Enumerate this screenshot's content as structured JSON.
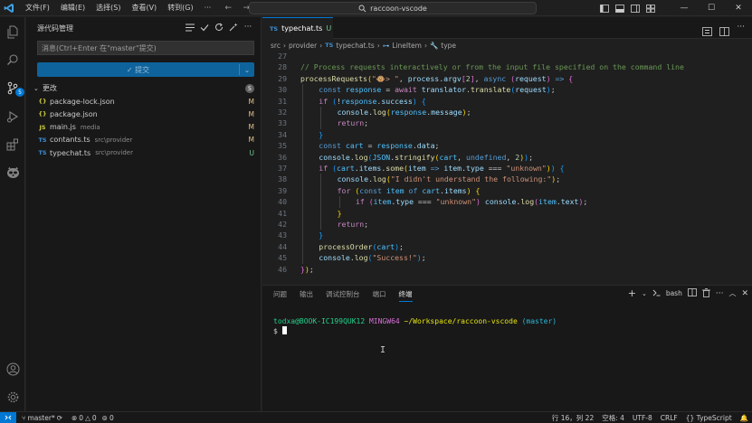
{
  "titlebar": {
    "menus": [
      "文件(F)",
      "编辑(E)",
      "选择(S)",
      "查看(V)",
      "转到(G)",
      "···"
    ],
    "search": "raccoon-vscode"
  },
  "activity_badge": "5",
  "scm": {
    "title": "源代码管理",
    "message_placeholder": "消息(Ctrl+Enter 在\"master\"提交)",
    "commit_label": "提交",
    "changes_label": "更改",
    "changes_count": "5",
    "files": [
      {
        "type": "{}",
        "type_color": "#cbcb41",
        "name": "package-lock.json",
        "path": "",
        "status": "M",
        "status_color": "#e2c08d"
      },
      {
        "type": "{}",
        "type_color": "#cbcb41",
        "name": "package.json",
        "path": "",
        "status": "M",
        "status_color": "#e2c08d"
      },
      {
        "type": "JS",
        "type_color": "#cbcb41",
        "name": "main.js",
        "path": "media",
        "status": "M",
        "status_color": "#e2c08d"
      },
      {
        "type": "TS",
        "type_color": "#3c8fd6",
        "name": "contants.ts",
        "path": "src\\provider",
        "status": "M",
        "status_color": "#e2c08d"
      },
      {
        "type": "TS",
        "type_color": "#3c8fd6",
        "name": "typechat.ts",
        "path": "src\\provider",
        "status": "U",
        "status_color": "#73c991"
      }
    ]
  },
  "editor": {
    "tab": {
      "type": "TS",
      "name": "typechat.ts",
      "status": "U"
    },
    "breadcrumb": {
      "p1": "src",
      "p2": "provider",
      "p3_type": "TS",
      "p3": "typechat.ts",
      "p4": "LineItem",
      "p5": "type"
    },
    "lines": [
      {
        "n": "27",
        "indent": 0,
        "tokens": []
      },
      {
        "n": "28",
        "indent": 0,
        "tokens": [
          [
            "// Process requests interactively or from the input file specified on the command line",
            "c-com"
          ]
        ]
      },
      {
        "n": "29",
        "indent": 0,
        "tokens": [
          [
            "processRequests",
            "c-fn"
          ],
          [
            "(",
            "c-br1"
          ],
          [
            "\"",
            "c-str"
          ],
          [
            "🐵",
            "c-str"
          ],
          [
            "> \"",
            "c-str"
          ],
          [
            ", ",
            "c-pun"
          ],
          [
            "process",
            "c-var"
          ],
          [
            ".",
            "c-pun"
          ],
          [
            "argv",
            "c-var"
          ],
          [
            "[",
            "c-br2"
          ],
          [
            "2",
            "c-num"
          ],
          [
            "]",
            "c-br2"
          ],
          [
            ", ",
            "c-pun"
          ],
          [
            "async",
            "c-kw"
          ],
          [
            " ",
            "c-pun"
          ],
          [
            "(",
            "c-br2"
          ],
          [
            "request",
            "c-var"
          ],
          [
            ")",
            "c-br2"
          ],
          [
            " ",
            "c-pun"
          ],
          [
            "=>",
            "c-kw"
          ],
          [
            " ",
            "c-pun"
          ],
          [
            "{",
            "c-br2"
          ]
        ]
      },
      {
        "n": "30",
        "indent": 1,
        "tokens": [
          [
            "const",
            "c-kw"
          ],
          [
            " ",
            "c-pun"
          ],
          [
            "response",
            "c-const"
          ],
          [
            " = ",
            "c-pun"
          ],
          [
            "await",
            "c-ctl"
          ],
          [
            " ",
            "c-pun"
          ],
          [
            "translator",
            "c-var"
          ],
          [
            ".",
            "c-pun"
          ],
          [
            "translate",
            "c-fn"
          ],
          [
            "(",
            "c-br3"
          ],
          [
            "request",
            "c-var"
          ],
          [
            ")",
            "c-br3"
          ],
          [
            ";",
            "c-pun"
          ]
        ]
      },
      {
        "n": "31",
        "indent": 1,
        "tokens": [
          [
            "if",
            "c-ctl"
          ],
          [
            " ",
            "c-pun"
          ],
          [
            "(",
            "c-br3"
          ],
          [
            "!",
            "c-pun"
          ],
          [
            "response",
            "c-const"
          ],
          [
            ".",
            "c-pun"
          ],
          [
            "success",
            "c-var"
          ],
          [
            ")",
            "c-br3"
          ],
          [
            " ",
            "c-pun"
          ],
          [
            "{",
            "c-br3"
          ]
        ]
      },
      {
        "n": "32",
        "indent": 2,
        "tokens": [
          [
            "console",
            "c-var"
          ],
          [
            ".",
            "c-pun"
          ],
          [
            "log",
            "c-fn"
          ],
          [
            "(",
            "c-br1"
          ],
          [
            "response",
            "c-const"
          ],
          [
            ".",
            "c-pun"
          ],
          [
            "message",
            "c-var"
          ],
          [
            ")",
            "c-br1"
          ],
          [
            ";",
            "c-pun"
          ]
        ]
      },
      {
        "n": "33",
        "indent": 2,
        "tokens": [
          [
            "return",
            "c-ctl"
          ],
          [
            ";",
            "c-pun"
          ]
        ]
      },
      {
        "n": "34",
        "indent": 1,
        "tokens": [
          [
            "}",
            "c-br3"
          ]
        ]
      },
      {
        "n": "35",
        "indent": 1,
        "tokens": [
          [
            "const",
            "c-kw"
          ],
          [
            " ",
            "c-pun"
          ],
          [
            "cart",
            "c-const"
          ],
          [
            " = ",
            "c-pun"
          ],
          [
            "response",
            "c-const"
          ],
          [
            ".",
            "c-pun"
          ],
          [
            "data",
            "c-var"
          ],
          [
            ";",
            "c-pun"
          ]
        ]
      },
      {
        "n": "36",
        "indent": 1,
        "tokens": [
          [
            "console",
            "c-var"
          ],
          [
            ".",
            "c-pun"
          ],
          [
            "log",
            "c-fn"
          ],
          [
            "(",
            "c-br3"
          ],
          [
            "JSON",
            "c-const"
          ],
          [
            ".",
            "c-pun"
          ],
          [
            "stringify",
            "c-fn"
          ],
          [
            "(",
            "c-br1"
          ],
          [
            "cart",
            "c-const"
          ],
          [
            ", ",
            "c-pun"
          ],
          [
            "undefined",
            "c-kw"
          ],
          [
            ", ",
            "c-pun"
          ],
          [
            "2",
            "c-num"
          ],
          [
            ")",
            "c-br1"
          ],
          [
            ")",
            "c-br3"
          ],
          [
            ";",
            "c-pun"
          ]
        ]
      },
      {
        "n": "37",
        "indent": 1,
        "tokens": [
          [
            "if",
            "c-ctl"
          ],
          [
            " ",
            "c-pun"
          ],
          [
            "(",
            "c-br3"
          ],
          [
            "cart",
            "c-const"
          ],
          [
            ".",
            "c-pun"
          ],
          [
            "items",
            "c-var"
          ],
          [
            ".",
            "c-pun"
          ],
          [
            "some",
            "c-fn"
          ],
          [
            "(",
            "c-br1"
          ],
          [
            "item",
            "c-var"
          ],
          [
            " ",
            "c-pun"
          ],
          [
            "=>",
            "c-kw"
          ],
          [
            " ",
            "c-pun"
          ],
          [
            "item",
            "c-var"
          ],
          [
            ".",
            "c-pun"
          ],
          [
            "type",
            "c-var"
          ],
          [
            " === ",
            "c-pun"
          ],
          [
            "\"unknown\"",
            "c-str"
          ],
          [
            ")",
            "c-br1"
          ],
          [
            ")",
            "c-br3"
          ],
          [
            " ",
            "c-pun"
          ],
          [
            "{",
            "c-br3"
          ]
        ]
      },
      {
        "n": "38",
        "indent": 2,
        "tokens": [
          [
            "console",
            "c-var"
          ],
          [
            ".",
            "c-pun"
          ],
          [
            "log",
            "c-fn"
          ],
          [
            "(",
            "c-br1"
          ],
          [
            "\"I didn't understand the following:\"",
            "c-str"
          ],
          [
            ")",
            "c-br1"
          ],
          [
            ";",
            "c-pun"
          ]
        ]
      },
      {
        "n": "39",
        "indent": 2,
        "tokens": [
          [
            "for",
            "c-ctl"
          ],
          [
            " ",
            "c-pun"
          ],
          [
            "(",
            "c-br1"
          ],
          [
            "const",
            "c-kw"
          ],
          [
            " ",
            "c-pun"
          ],
          [
            "item",
            "c-const"
          ],
          [
            " ",
            "c-pun"
          ],
          [
            "of",
            "c-kw"
          ],
          [
            " ",
            "c-pun"
          ],
          [
            "cart",
            "c-const"
          ],
          [
            ".",
            "c-pun"
          ],
          [
            "items",
            "c-var"
          ],
          [
            ")",
            "c-br1"
          ],
          [
            " ",
            "c-pun"
          ],
          [
            "{",
            "c-br1"
          ]
        ]
      },
      {
        "n": "40",
        "indent": 3,
        "tokens": [
          [
            "if",
            "c-ctl"
          ],
          [
            " ",
            "c-pun"
          ],
          [
            "(",
            "c-br2"
          ],
          [
            "item",
            "c-const"
          ],
          [
            ".",
            "c-pun"
          ],
          [
            "type",
            "c-var"
          ],
          [
            " === ",
            "c-pun"
          ],
          [
            "\"unknown\"",
            "c-str"
          ],
          [
            ")",
            "c-br2"
          ],
          [
            " ",
            "c-pun"
          ],
          [
            "console",
            "c-var"
          ],
          [
            ".",
            "c-pun"
          ],
          [
            "log",
            "c-fn"
          ],
          [
            "(",
            "c-br2"
          ],
          [
            "item",
            "c-const"
          ],
          [
            ".",
            "c-pun"
          ],
          [
            "text",
            "c-var"
          ],
          [
            ")",
            "c-br2"
          ],
          [
            ";",
            "c-pun"
          ]
        ]
      },
      {
        "n": "41",
        "indent": 2,
        "tokens": [
          [
            "}",
            "c-br1"
          ]
        ]
      },
      {
        "n": "42",
        "indent": 2,
        "tokens": [
          [
            "return",
            "c-ctl"
          ],
          [
            ";",
            "c-pun"
          ]
        ]
      },
      {
        "n": "43",
        "indent": 1,
        "tokens": [
          [
            "}",
            "c-br3"
          ]
        ]
      },
      {
        "n": "44",
        "indent": 1,
        "tokens": [
          [
            "processOrder",
            "c-fn"
          ],
          [
            "(",
            "c-br3"
          ],
          [
            "cart",
            "c-const"
          ],
          [
            ")",
            "c-br3"
          ],
          [
            ";",
            "c-pun"
          ]
        ]
      },
      {
        "n": "45",
        "indent": 1,
        "tokens": [
          [
            "console",
            "c-var"
          ],
          [
            ".",
            "c-pun"
          ],
          [
            "log",
            "c-fn"
          ],
          [
            "(",
            "c-br3"
          ],
          [
            "\"Success!\"",
            "c-str"
          ],
          [
            ")",
            "c-br3"
          ],
          [
            ";",
            "c-pun"
          ]
        ]
      },
      {
        "n": "46",
        "indent": 0,
        "tokens": [
          [
            "}",
            "c-br2"
          ],
          [
            ")",
            "c-br1"
          ],
          [
            ";",
            "c-pun"
          ]
        ]
      }
    ]
  },
  "panel": {
    "tabs": [
      "问题",
      "输出",
      "调试控制台",
      "端口",
      "终端"
    ],
    "active_tab": "终端",
    "shell": "bash",
    "prompt": {
      "user": "todxa@BOOK-IC199QUK12",
      "ming": "MINGW64",
      "path": "~/Workspace/raccoon-vscode",
      "branch": "(master)",
      "symbol": "$"
    }
  },
  "status": {
    "branch": "master*",
    "errors": "0",
    "warnings": "0",
    "ports": "0",
    "position": "行 16，列 22",
    "spaces": "空格: 4",
    "encoding": "UTF-8",
    "eol": "CRLF",
    "language": "TypeScript"
  },
  "colors": {
    "accent": "#0078d4",
    "modified": "#e2c08d",
    "untracked": "#73c991"
  }
}
